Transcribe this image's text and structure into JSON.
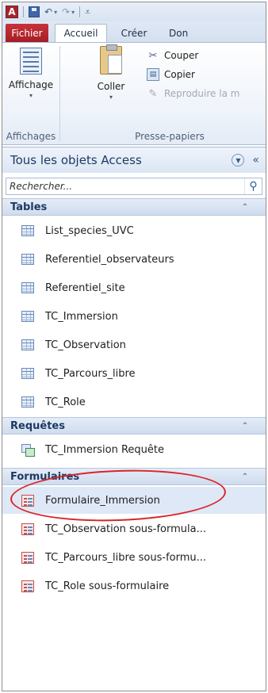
{
  "quick_access": {
    "app_logo": "A",
    "save_icon": "save-icon",
    "undo_icon": "undo-icon",
    "redo_icon": "redo-icon",
    "customize_icon": "customize-qat-icon"
  },
  "tabs": [
    {
      "label": "Fichier"
    },
    {
      "label": "Accueil"
    },
    {
      "label": "Créer"
    },
    {
      "label": "Don"
    }
  ],
  "ribbon": {
    "affichages_group": {
      "button_label": "Affichage",
      "group_label": "Affichages"
    },
    "clipboard_group": {
      "paste_label": "Coller",
      "cut_label": "Couper",
      "copy_label": "Copier",
      "format_painter_label": "Reproduire la m",
      "group_label": "Presse-papiers"
    }
  },
  "nav": {
    "title": "Tous les objets Access",
    "search_placeholder": "Rechercher...",
    "sections": {
      "tables": {
        "title": "Tables",
        "items": [
          {
            "label": "List_species_UVC"
          },
          {
            "label": "Referentiel_observateurs"
          },
          {
            "label": "Referentiel_site"
          },
          {
            "label": "TC_Immersion"
          },
          {
            "label": "TC_Observation"
          },
          {
            "label": "TC_Parcours_libre"
          },
          {
            "label": "TC_Role"
          }
        ]
      },
      "queries": {
        "title": "Requêtes",
        "items": [
          {
            "label": "TC_Immersion Requête"
          }
        ]
      },
      "forms": {
        "title": "Formulaires",
        "items": [
          {
            "label": "Formulaire_Immersion"
          },
          {
            "label": "TC_Observation sous-formula..."
          },
          {
            "label": "TC_Parcours_libre sous-formu..."
          },
          {
            "label": "TC_Role sous-formulaire"
          }
        ]
      }
    }
  },
  "colors": {
    "accent_red": "#c8323a",
    "annotation_circle": "#d8262b",
    "section_header": "#cfdcee"
  }
}
